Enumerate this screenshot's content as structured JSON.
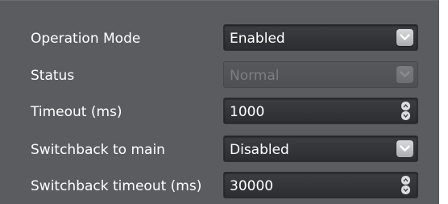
{
  "settings": [
    {
      "label": "Operation Mode",
      "value": "Enabled",
      "control": "dropdown",
      "enabled": true
    },
    {
      "label": "Status",
      "value": "Normal",
      "control": "dropdown",
      "enabled": false
    },
    {
      "label": "Timeout (ms)",
      "value": "1000",
      "control": "spinner",
      "enabled": true
    },
    {
      "label": "Switchback to main",
      "value": "Disabled",
      "control": "dropdown",
      "enabled": true
    },
    {
      "label": "Switchback timeout (ms)",
      "value": "30000",
      "control": "spinner",
      "enabled": true
    }
  ],
  "icons": {
    "dropdown": "chevron-down-icon",
    "spin_up": "chevron-up-icon",
    "spin_down": "chevron-down-icon"
  },
  "colors": {
    "panel_bg": "#5a5c60",
    "field_bg": "#333438",
    "text": "#ffffff",
    "disabled_text": "#7c7e82"
  }
}
